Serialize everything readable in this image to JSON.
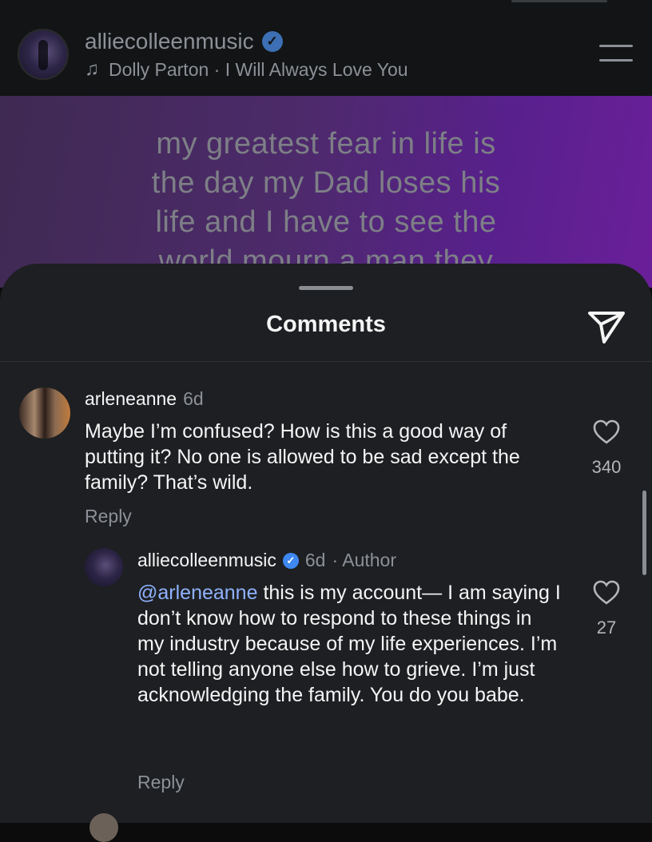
{
  "reel": {
    "username": "alliecolleenmusic",
    "music": "Dolly Parton · I Will Always Love You",
    "overlay_lines": [
      "my greatest fear in life is",
      "the day my Dad loses his",
      "life and I have to see the",
      "world mourn a man they"
    ]
  },
  "sheet": {
    "title": "Comments"
  },
  "comments": [
    {
      "username": "arleneanne",
      "time": "6d",
      "text": "Maybe I’m confused? How is this a good way of putting it? No one is allowed to be sad except the family? That’s wild.",
      "reply_label": "Reply",
      "likes": "340",
      "replies": [
        {
          "username": "alliecolleenmusic",
          "time": "6d",
          "role": "· Author",
          "mention": "@arleneanne",
          "text": " this is my account— I am saying I don’t know how to respond to these things in my industry because of my life experiences. I’m not telling anyone else how to grieve.  I’m just acknowledging the family. You do you babe.",
          "reply_label": "Reply",
          "likes": "27"
        }
      ]
    }
  ],
  "colors": {
    "sheet_bg": "#1d1f22",
    "verified_badge": "#3e88f0",
    "mention": "#8fb2ff",
    "muted_text": "#8d9197"
  },
  "icons": [
    "music-note-icon",
    "menu-icon",
    "verified-badge-icon",
    "share-icon",
    "heart-icon"
  ]
}
